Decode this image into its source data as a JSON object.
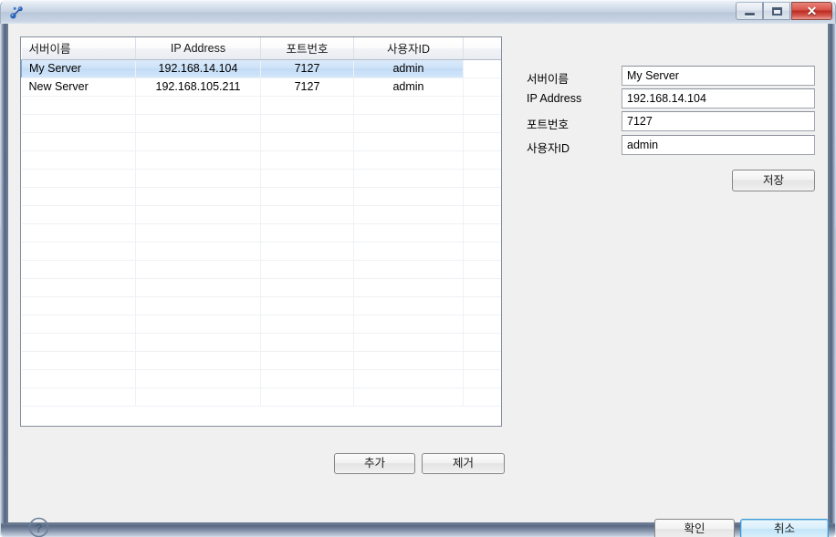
{
  "window": {
    "title": "",
    "app_icon": "molecule-icon",
    "controls": {
      "minimize_label": "",
      "maximize_label": "",
      "close_label": "✕"
    }
  },
  "table": {
    "columns": [
      "서버이름",
      "IP Address",
      "포트번호",
      "사용자ID",
      ""
    ],
    "rows": [
      {
        "server_name": "My Server",
        "ip_address": "192.168.14.104",
        "port": "7127",
        "user_id": "admin",
        "selected": true
      },
      {
        "server_name": "New Server",
        "ip_address": "192.168.105.211",
        "port": "7127",
        "user_id": "admin",
        "selected": false
      }
    ],
    "empty_row_count": 17
  },
  "form": {
    "fields": [
      {
        "label": "서버이름",
        "value": "My Server",
        "placeholder": ""
      },
      {
        "label": "IP Address",
        "value": "192.168.14.104",
        "placeholder": ""
      },
      {
        "label": "포트번호",
        "value": "7127",
        "placeholder": ""
      },
      {
        "label": "사용자ID",
        "value": "admin",
        "placeholder": ""
      }
    ],
    "save_label": "저장"
  },
  "list_actions": {
    "add_label": "추가",
    "remove_label": "제거"
  },
  "dialog_actions": {
    "ok_label": "확인",
    "cancel_label": "취소",
    "help_icon": "question-mark-icon",
    "default_button": "취소"
  },
  "colors": {
    "dialog_background": "#f0f0f0",
    "selection_blue": "#cde2f8",
    "selection_border": "#7aa8d6",
    "default_button_border": "#3c9ad4",
    "close_button_red": "#bb2a20",
    "window_border": "#6a7d96",
    "text": "#000000"
  }
}
